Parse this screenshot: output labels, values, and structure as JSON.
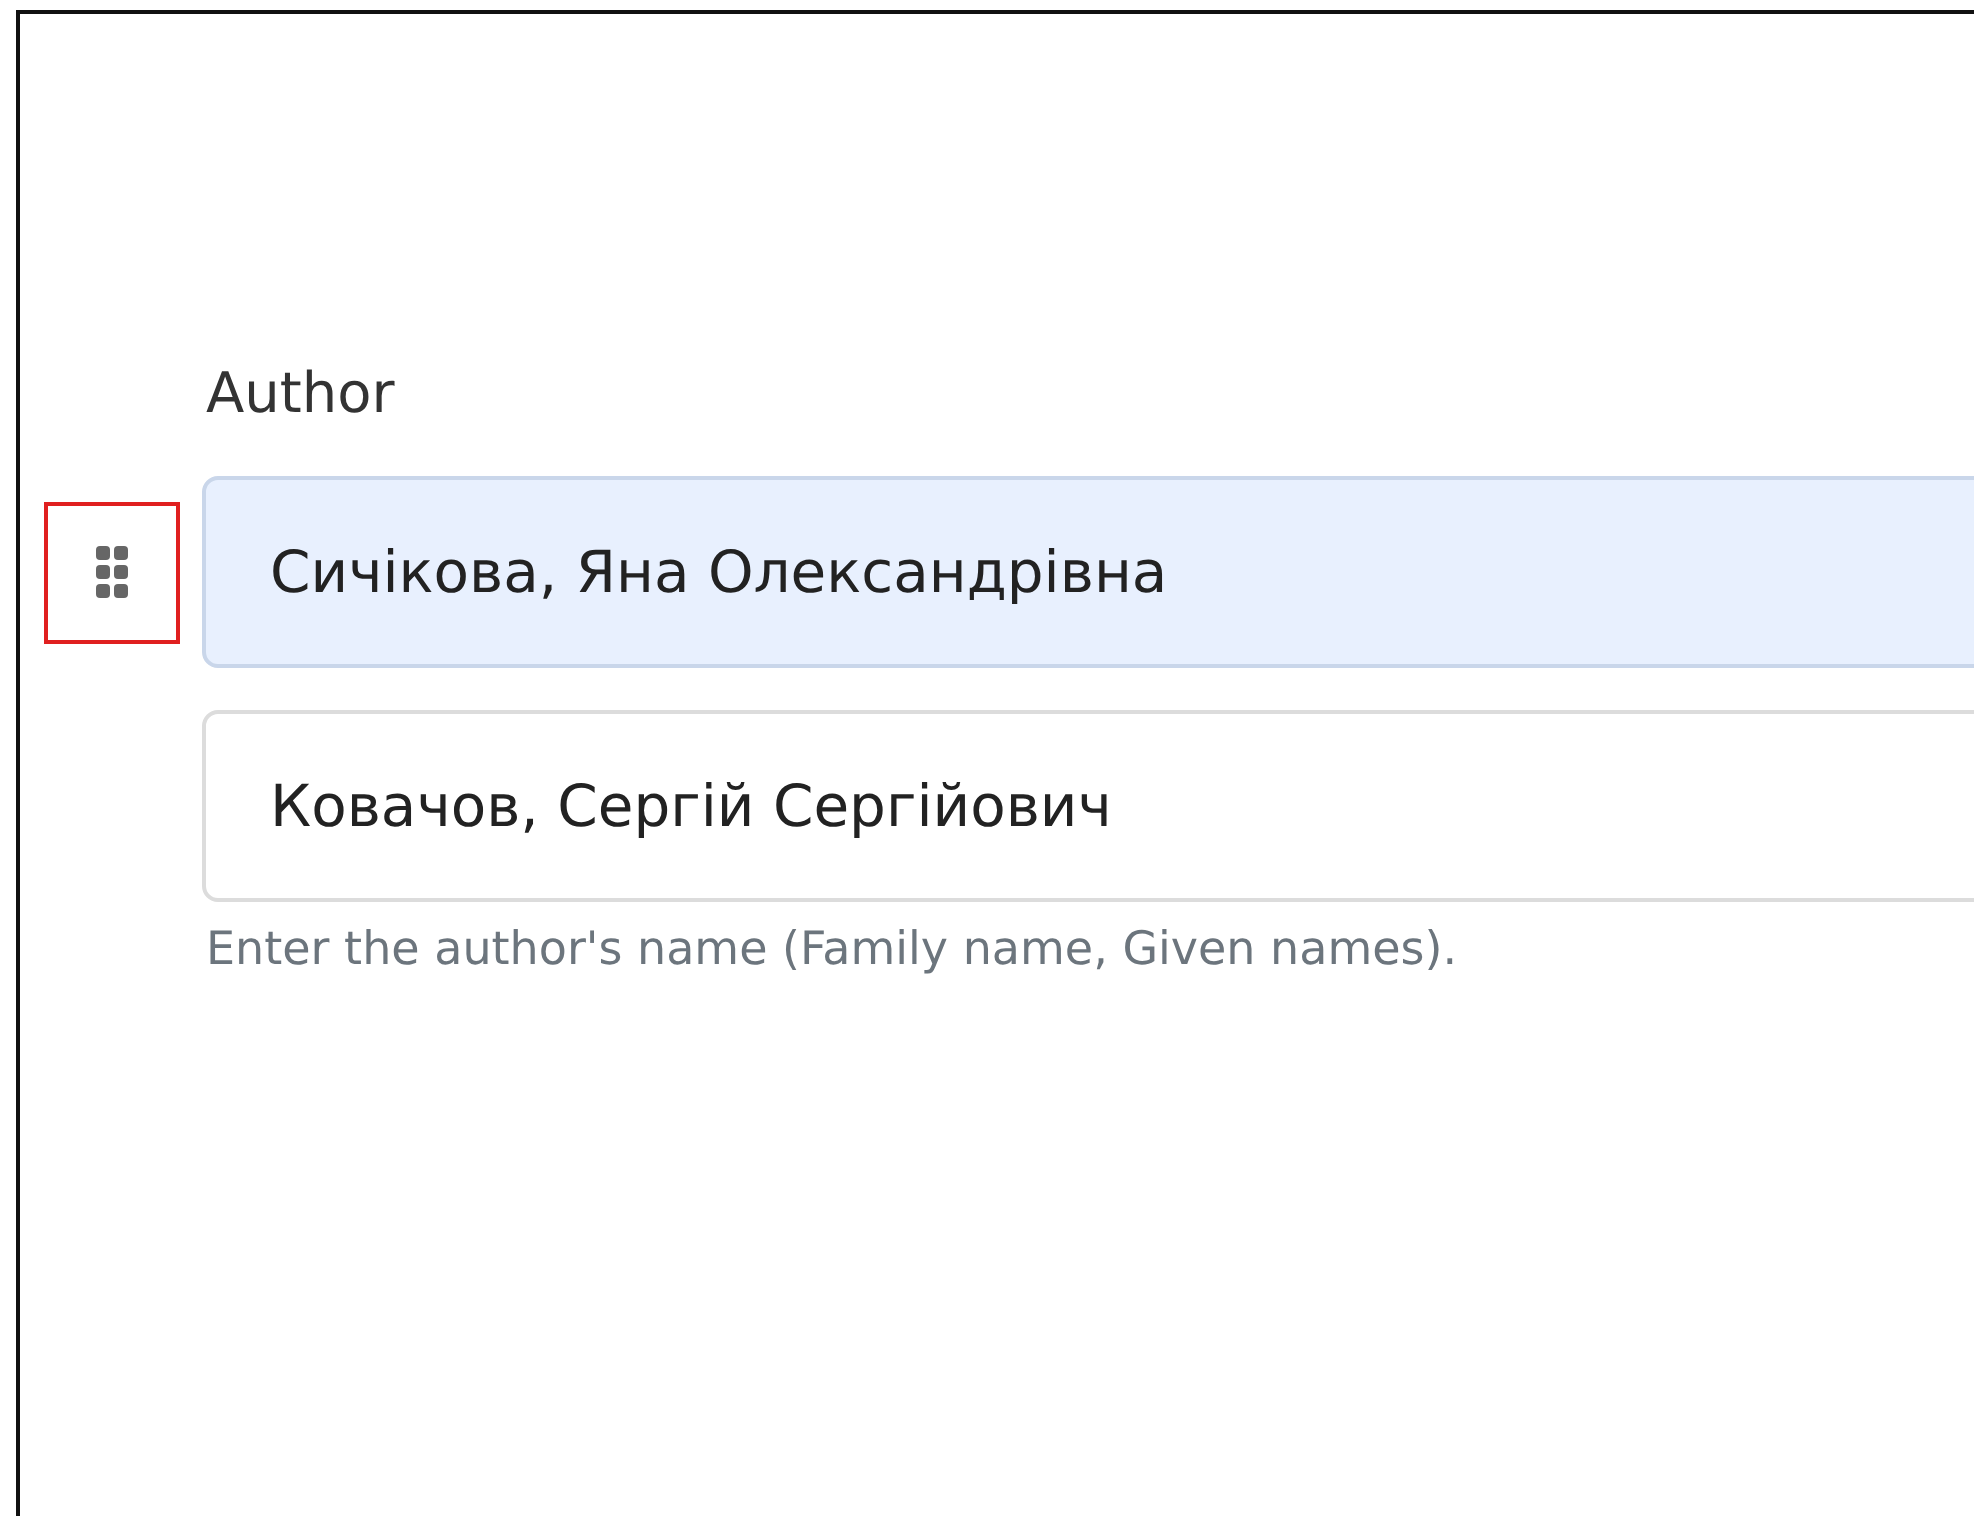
{
  "field": {
    "label": "Author",
    "entries": [
      {
        "value": "Сичікова, Яна Олександрівна",
        "selected": true
      },
      {
        "value": "Ковачов, Сергій Сергійович",
        "selected": false
      }
    ],
    "help": "Enter the author's name (Family name, Given names)."
  }
}
